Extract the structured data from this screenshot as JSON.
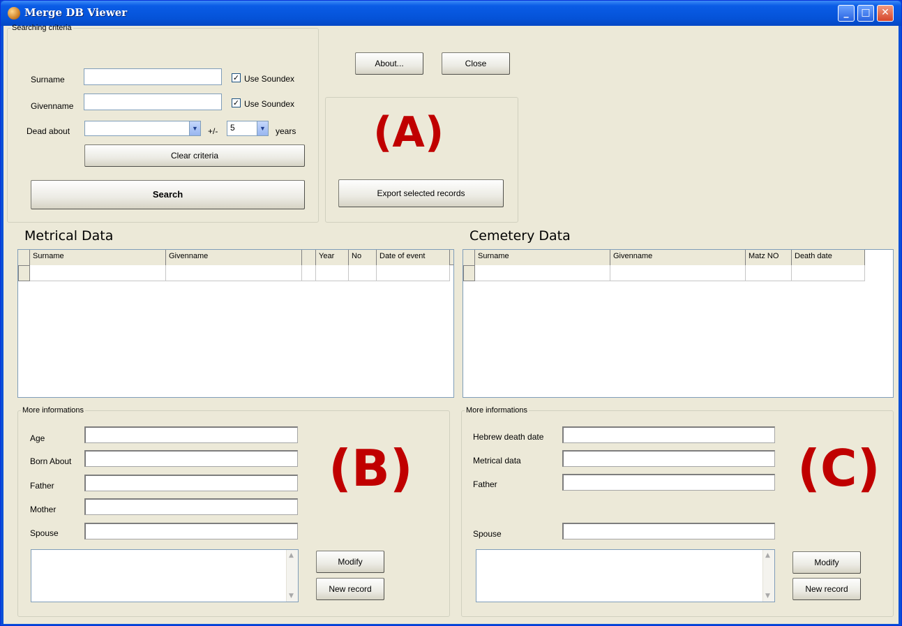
{
  "window": {
    "title": "Merge DB Viewer"
  },
  "search": {
    "legend": "Searching criteria",
    "surname_label": "Surname",
    "givenname_label": "Givenname",
    "soundex_label": "Use Soundex",
    "dead_about_label": "Dead about",
    "plusminus_label": "+/-",
    "range_value": "5",
    "years_label": "years",
    "clear_button": "Clear criteria",
    "search_button": "Search"
  },
  "toolbar": {
    "about_button": "About...",
    "close_button": "Close",
    "export_button": "Export selected records"
  },
  "annotations": {
    "a": "(A)",
    "b": "(B)",
    "c": "(C)"
  },
  "metrical": {
    "title": "Metrical Data",
    "columns": [
      "Surname",
      "Givenname",
      "",
      "Year",
      "No",
      "Date of event"
    ]
  },
  "cemetery": {
    "title": "Cemetery Data",
    "columns": [
      "Surname",
      "Givenname",
      "Matz NO",
      "Death date"
    ]
  },
  "more_left": {
    "legend": "More informations",
    "fields": [
      "Age",
      "Born About",
      "Father",
      "Mother",
      "Spouse"
    ],
    "modify_button": "Modify",
    "new_button": "New record"
  },
  "more_right": {
    "legend": "More informations",
    "fields": [
      "Hebrew death date",
      "Metrical data",
      "Father",
      "Spouse"
    ],
    "modify_button": "Modify",
    "new_button": "New record"
  },
  "colors": {
    "titlebar": "#0553d8",
    "annotation": "#c00000",
    "client": "#ece9d8"
  }
}
